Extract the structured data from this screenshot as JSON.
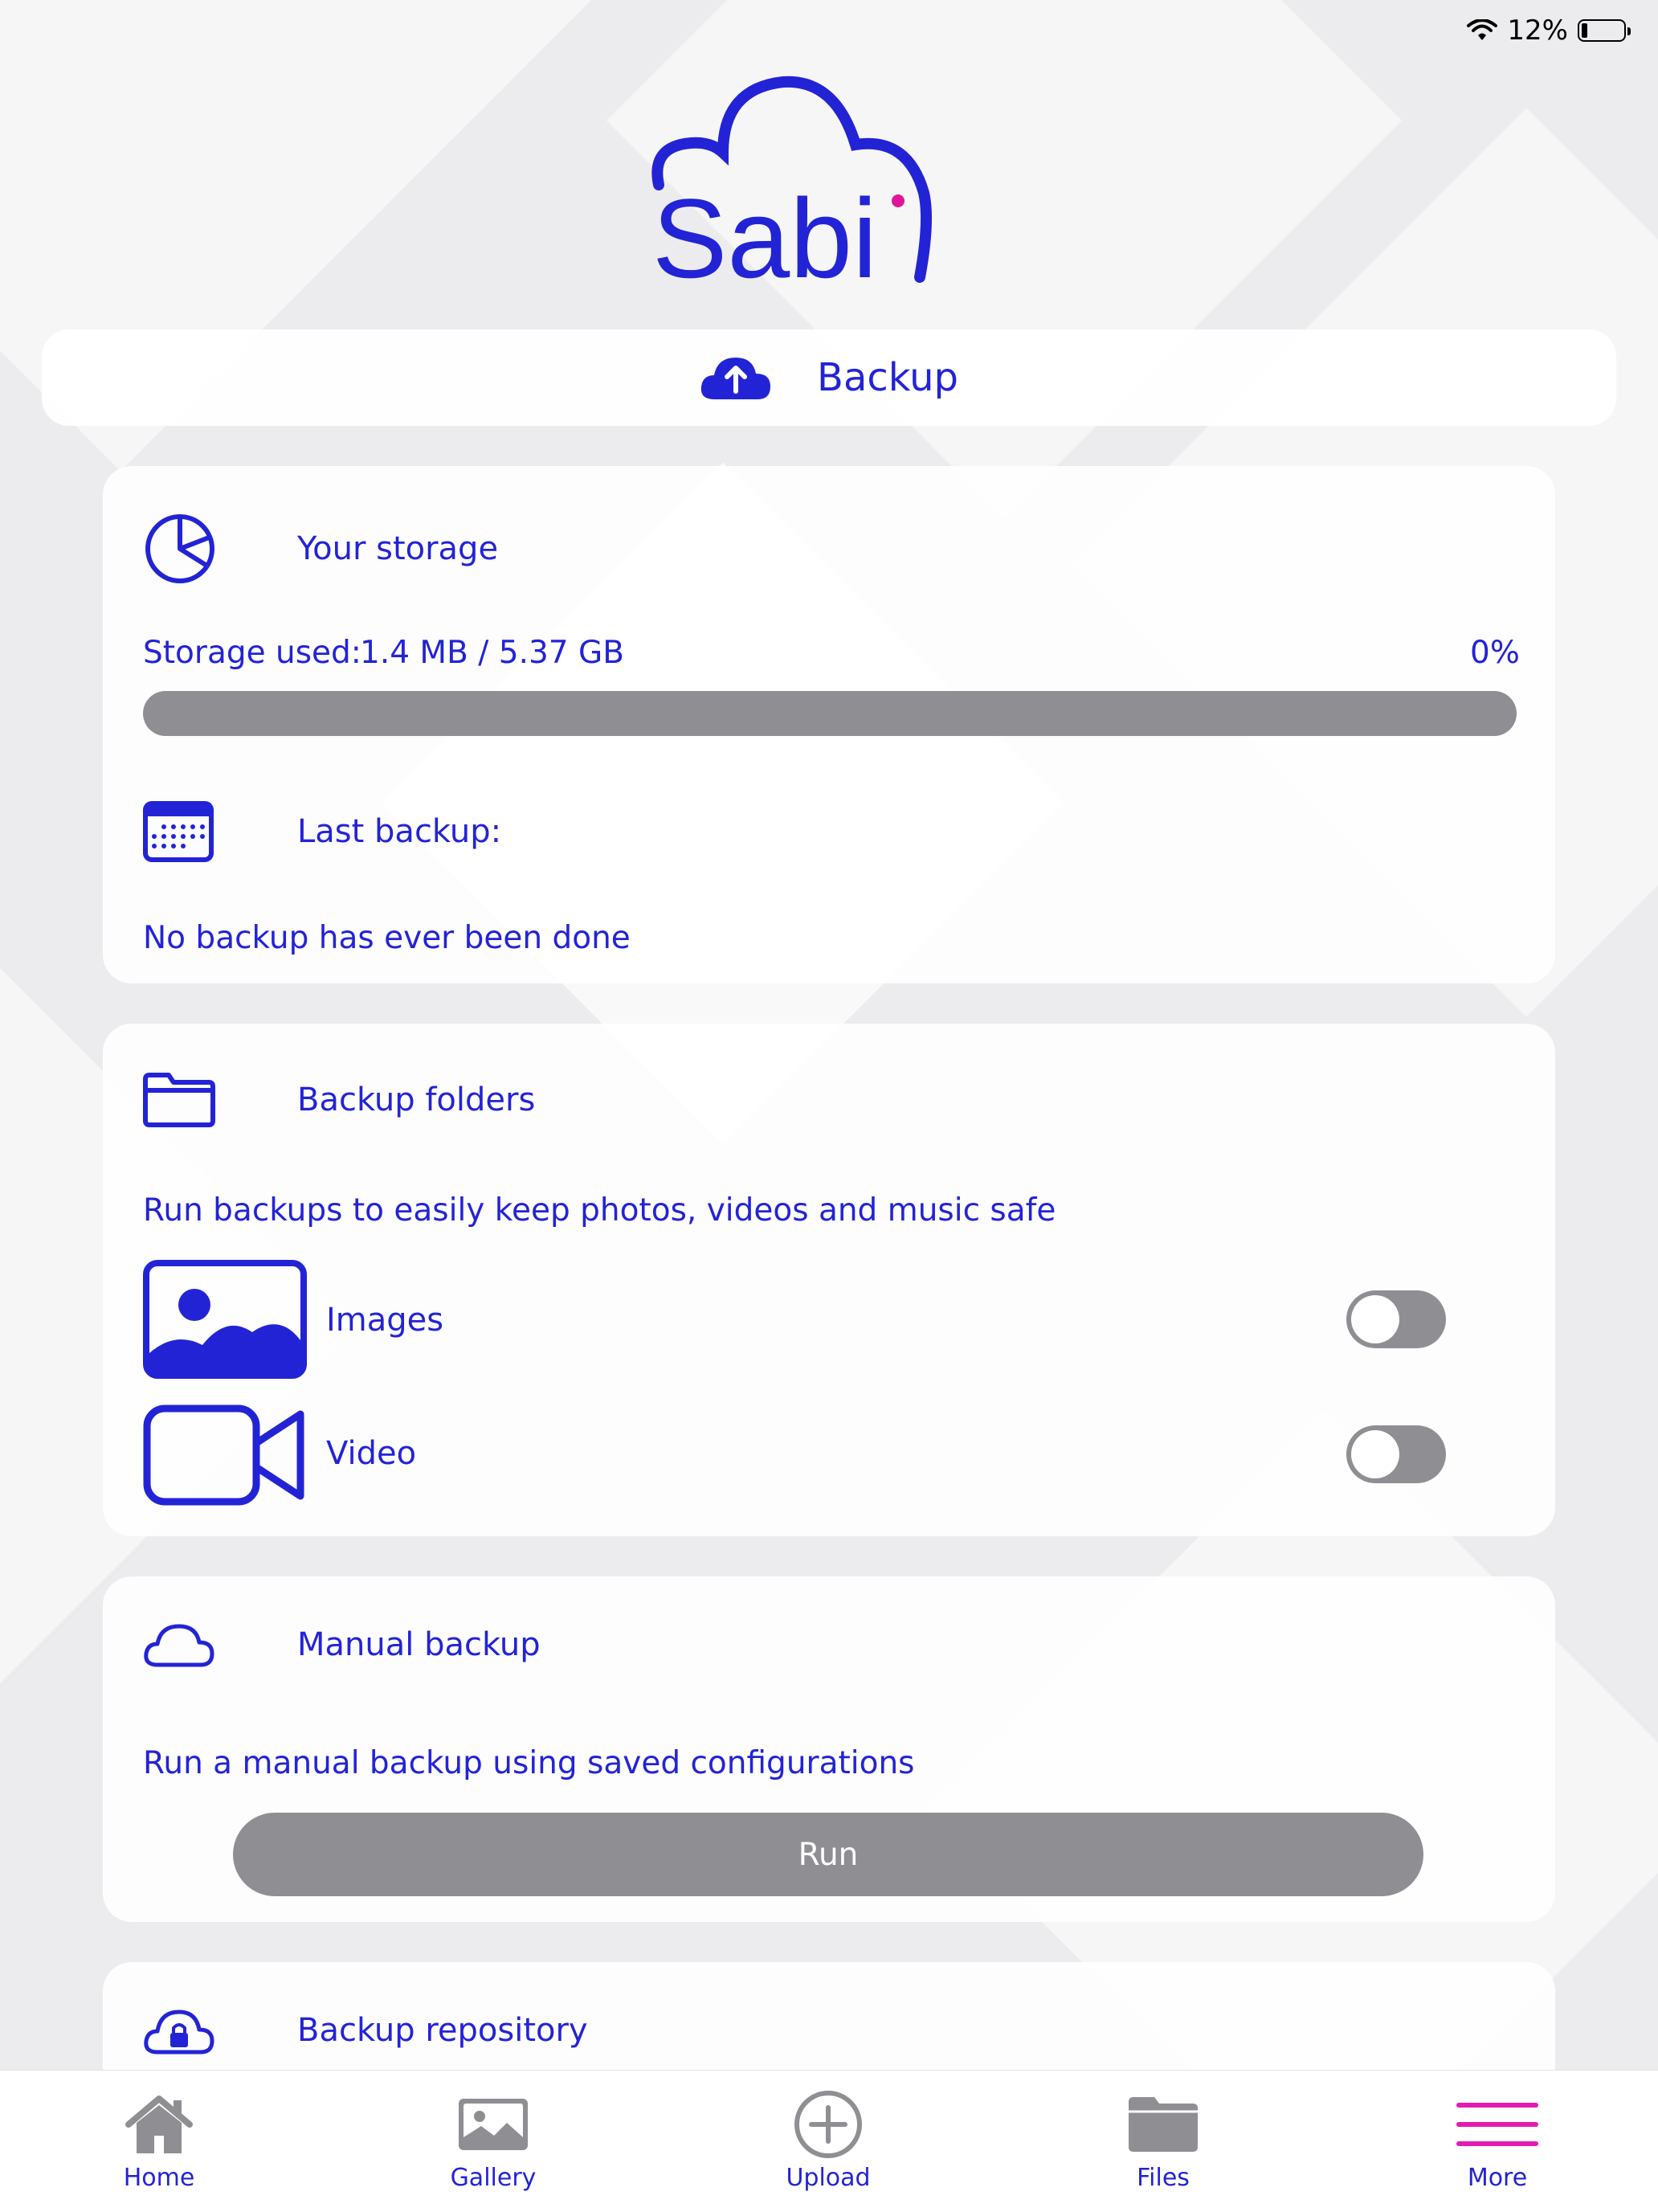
{
  "status_bar": {
    "battery": "12%"
  },
  "app": {
    "logo_text": "Sabi"
  },
  "header": {
    "title": "Backup"
  },
  "storage": {
    "title": "Your storage",
    "used_label": "Storage used:",
    "used_value": "1.4 MB / 5.37 GB",
    "percent": "0%",
    "progress_fraction": 0.0
  },
  "last_backup": {
    "title": "Last backup:",
    "message": "No backup has ever been done"
  },
  "backup_folders": {
    "title": "Backup folders",
    "description": "Run backups to easily keep photos, videos and music safe",
    "items": [
      {
        "label": "Images",
        "enabled": false
      },
      {
        "label": "Video",
        "enabled": false
      }
    ]
  },
  "manual_backup": {
    "title": "Manual backup",
    "description": "Run a manual backup using saved configurations",
    "run_label": "Run"
  },
  "repository": {
    "title": "Backup repository"
  },
  "tabbar": {
    "items": [
      {
        "label": "Home",
        "icon": "home-icon"
      },
      {
        "label": "Gallery",
        "icon": "gallery-icon"
      },
      {
        "label": "Upload",
        "icon": "upload-icon"
      },
      {
        "label": "Files",
        "icon": "folder-icon"
      },
      {
        "label": "More",
        "icon": "menu-icon"
      }
    ],
    "active": "More"
  },
  "colors": {
    "accent": "#2323d6",
    "brand_dot": "#e0159a",
    "disabled": "#8e8e93",
    "more_icon": "#e41bb0"
  }
}
